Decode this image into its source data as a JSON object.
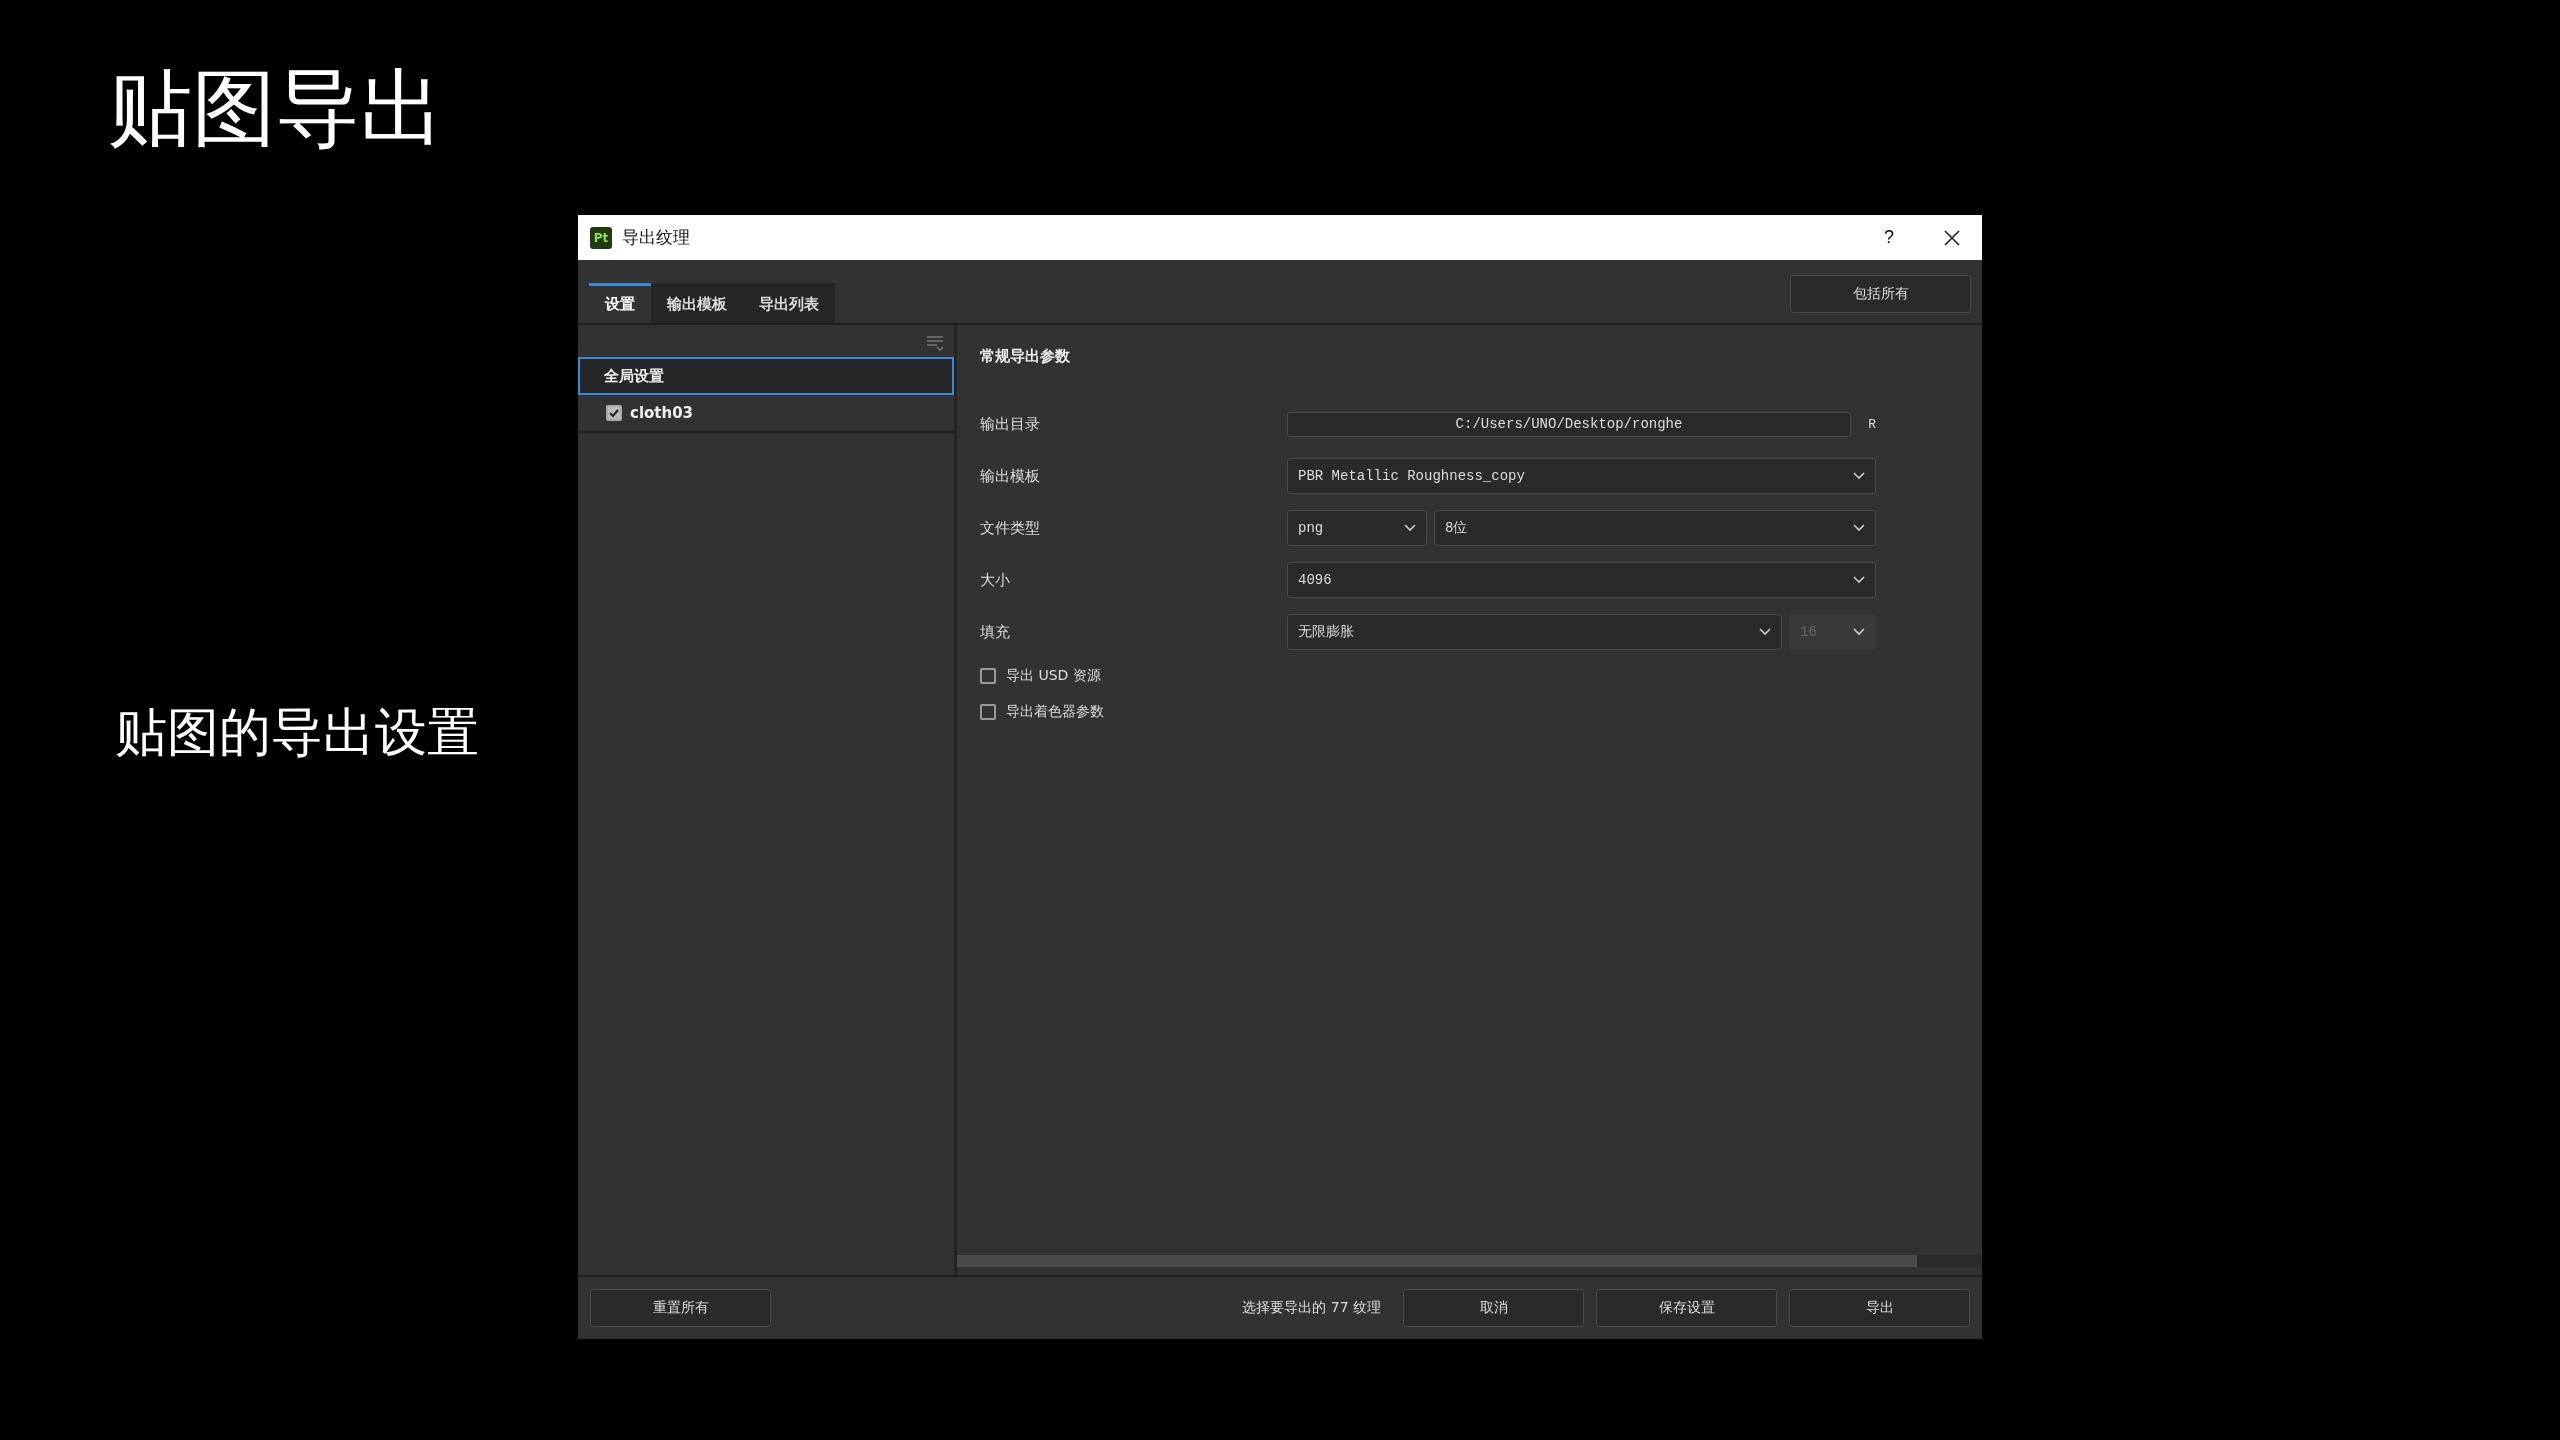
{
  "slide": {
    "title": "贴图导出",
    "subtitle": "贴图的导出设置"
  },
  "window": {
    "app_icon": "Pt",
    "title": "导出纹理",
    "help": "?"
  },
  "tabs": [
    {
      "label": "设置",
      "selected": true
    },
    {
      "label": "输出模板",
      "selected": false
    },
    {
      "label": "导出列表",
      "selected": false
    }
  ],
  "include_all_button": "包括所有",
  "sidebar": {
    "items": [
      {
        "kind": "header",
        "label": "全局设置",
        "selected": true
      },
      {
        "kind": "checkbox",
        "label": "cloth03",
        "checked": true,
        "selected": false
      }
    ]
  },
  "section": {
    "heading": "常规导出参数",
    "fields": [
      {
        "kind": "path",
        "label": "输出目录",
        "value": "C:/Users/UNO/Desktop/ronghe",
        "suffix": "R"
      },
      {
        "kind": "select",
        "label": "输出模板",
        "value": "PBR Metallic Roughness_copy"
      },
      {
        "kind": "select_pair",
        "label": "文件类型",
        "values": [
          "png",
          "8位"
        ]
      },
      {
        "kind": "select",
        "label": "大小",
        "value": "4096"
      },
      {
        "kind": "select_extra",
        "label": "填充",
        "value": "无限膨胀",
        "extra": {
          "value": "16",
          "disabled": true
        }
      }
    ],
    "options": [
      {
        "label": "导出 USD 资源",
        "checked": false
      },
      {
        "label": "导出着色器参数",
        "checked": false
      }
    ]
  },
  "footer": {
    "reset_button": "重置所有",
    "status": "选择要导出的 77 纹理",
    "buttons": [
      "取消",
      "保存设置",
      "导出"
    ]
  }
}
